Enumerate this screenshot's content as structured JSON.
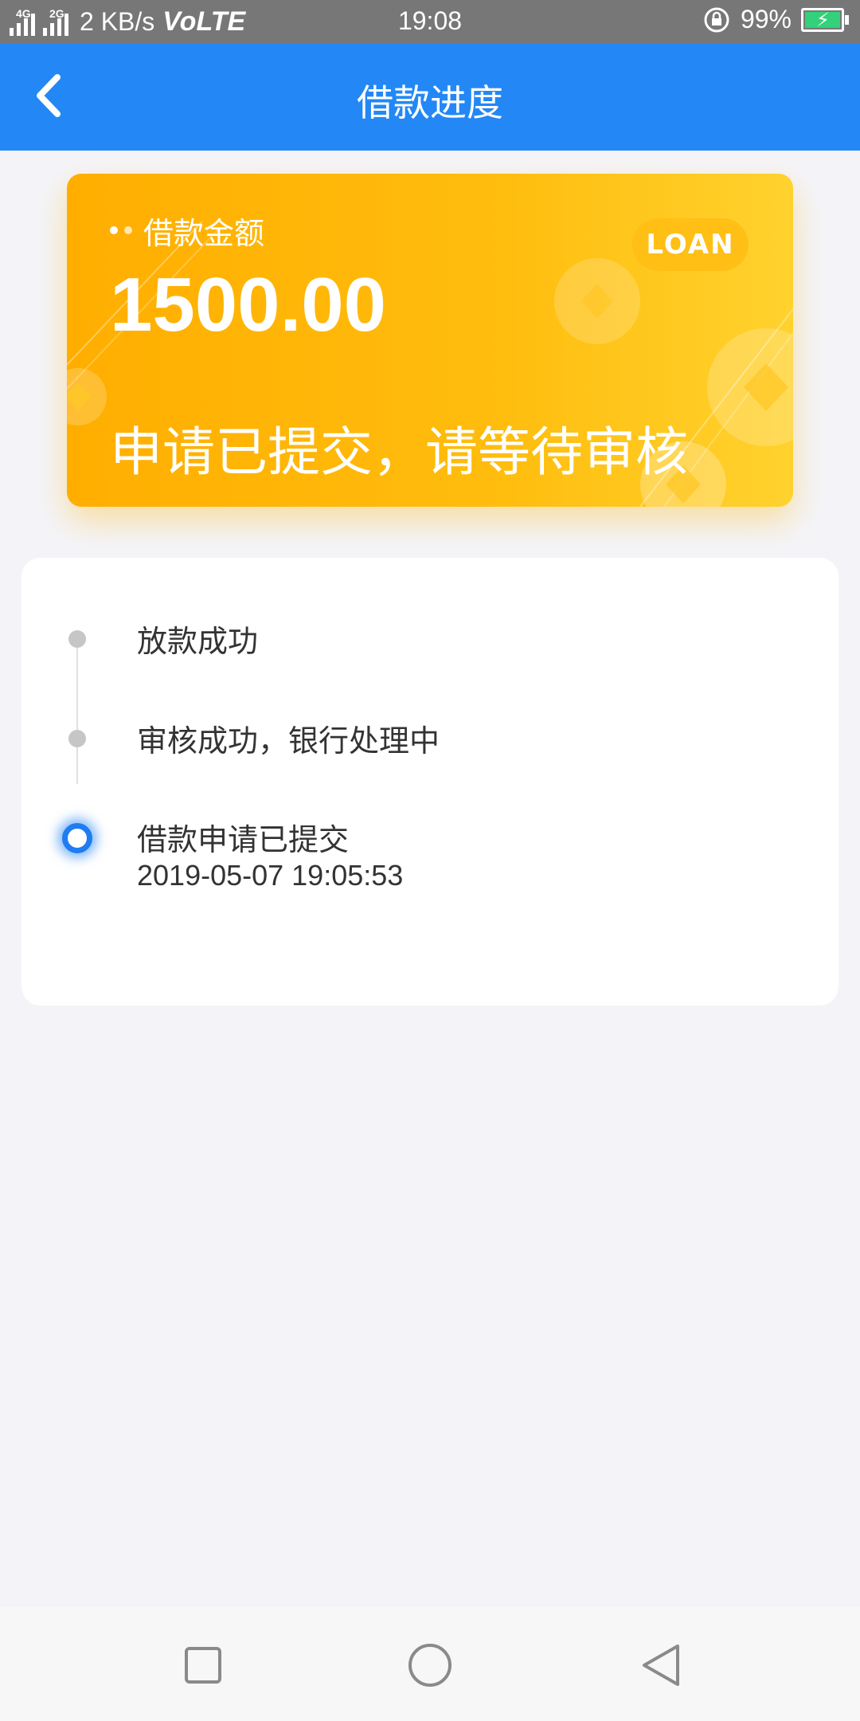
{
  "status_bar": {
    "network_1": "4G",
    "network_2": "2G",
    "speed": "2 KB/s",
    "volte": "VoLTE",
    "time": "19:08",
    "battery": "99%",
    "icons": [
      "signal-icon",
      "rotation-lock-icon",
      "battery-charging-icon"
    ]
  },
  "app_bar": {
    "title": "借款进度",
    "back_icon": "chevron-left-icon"
  },
  "loan_card": {
    "amount_label": "借款金额",
    "amount": "1500.00",
    "badge": "LOAN",
    "status": "申请已提交，请等待审核",
    "colors": {
      "start": "#ffae00",
      "end": "#ffd22e"
    }
  },
  "timeline": {
    "steps": [
      {
        "label": "放款成功",
        "state": "pending"
      },
      {
        "label": "审核成功，银行处理中",
        "state": "pending"
      },
      {
        "label": "借款申请已提交",
        "time": "2019-05-07 19:05:53",
        "state": "active"
      }
    ],
    "active_color": "#1e7df2",
    "inactive_color": "#c6c6c6"
  },
  "nav_bar": {
    "buttons": [
      "recent-apps-icon",
      "home-icon",
      "back-icon"
    ]
  },
  "colors": {
    "accent": "#2388f5",
    "background": "#f4f4f8"
  }
}
